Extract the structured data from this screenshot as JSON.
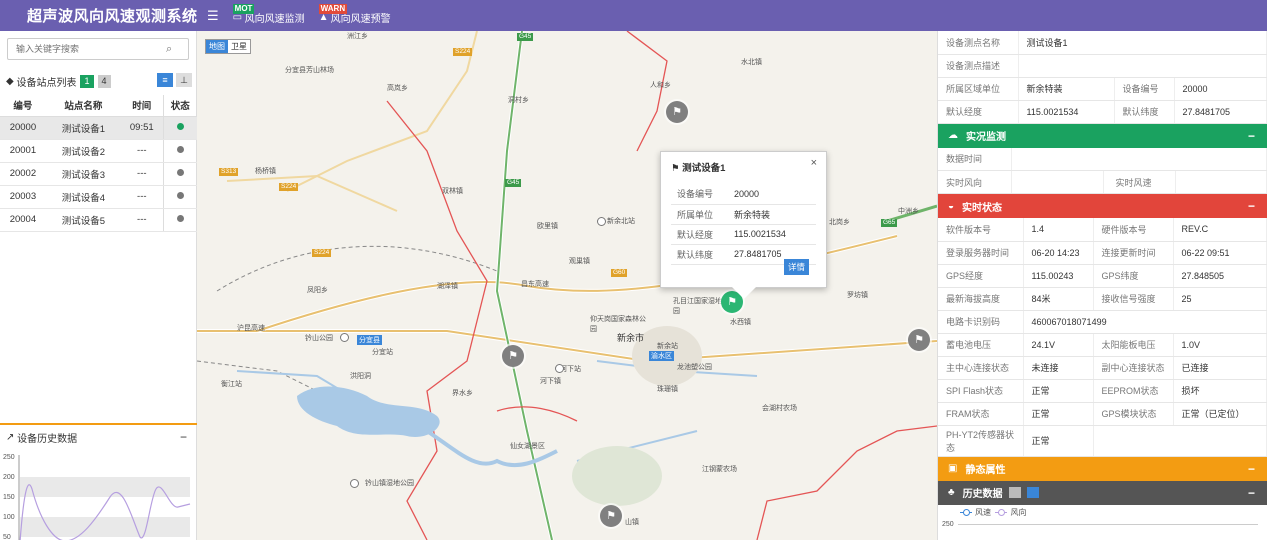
{
  "app": {
    "title": "超声波风向风速观测系统",
    "menu_icon": "hamburger-icon"
  },
  "nav": [
    {
      "tag": "MOT",
      "label": "风向风速监测",
      "icon": "monitor-icon"
    },
    {
      "tag": "WARN",
      "label": "风向风速预警",
      "icon": "warning-icon"
    }
  ],
  "left": {
    "search_placeholder": "输入关键字搜索",
    "list_title": "设备站点列表",
    "online_count": "1",
    "offline_count": "4",
    "columns": [
      "编号",
      "站点名称",
      "时间",
      "状态"
    ],
    "devices": [
      {
        "id": "20000",
        "name": "测试设备1",
        "time": "09:51",
        "status": "online"
      },
      {
        "id": "20001",
        "name": "测试设备2",
        "time": "---",
        "status": "offline"
      },
      {
        "id": "20002",
        "name": "测试设备3",
        "time": "---",
        "status": "offline"
      },
      {
        "id": "20003",
        "name": "测试设备4",
        "time": "---",
        "status": "offline"
      },
      {
        "id": "20004",
        "name": "测试设备5",
        "time": "---",
        "status": "offline"
      }
    ],
    "history_title": "设备历史数据",
    "history_y_ticks": [
      "250",
      "200",
      "150",
      "100",
      "50"
    ]
  },
  "map": {
    "type_buttons": [
      "地图",
      "卫星"
    ],
    "labels": [
      "分宜县芳山林场",
      "高岚乡",
      "洞村乡",
      "杨桥镇",
      "双林镇",
      "欧里镇",
      "新余北站",
      "观巢镇",
      "水北镇",
      "人和乡",
      "中洲乡",
      "罗坊镇",
      "凤阳乡",
      "湖泽镇",
      "昌东高速",
      "分宜县",
      "钤山公园",
      "分宜站",
      "孔目江国家湿地公园",
      "仰天岗国家森林公园",
      "新余市",
      "渝水区",
      "新余站",
      "河下站",
      "界水乡",
      "河下镇",
      "珠珊镇",
      "龙池塑公园",
      "洪阳洞",
      "衡江站",
      "沪昆高速",
      "会湖村农场",
      "江钢蒙农场",
      "仙女湖景区",
      "钤山镇湿地公园",
      "水西镇",
      "北岗乡",
      "洲江乡",
      "山镇"
    ],
    "road_tags": [
      "S224",
      "G45",
      "S313",
      "G60",
      "G45",
      "S224",
      "S224",
      "G65"
    ],
    "popup": {
      "title": "测试设备1",
      "rows": [
        {
          "k": "设备编号",
          "v": "20000"
        },
        {
          "k": "所属单位",
          "v": "新余特装"
        },
        {
          "k": "默认经度",
          "v": "115.0021534"
        },
        {
          "k": "默认纬度",
          "v": "27.8481705"
        }
      ],
      "detail_label": "详情"
    }
  },
  "right": {
    "info": {
      "name_k": "设备测点名称",
      "name_v": "测试设备1",
      "desc_k": "设备测点描述",
      "desc_v": "",
      "unit_k": "所属区域单位",
      "unit_v": "新余特装",
      "no_k": "设备编号",
      "no_v": "20000",
      "lng_k": "默认经度",
      "lng_v": "115.0021534",
      "lat_k": "默认纬度",
      "lat_v": "27.8481705"
    },
    "live": {
      "title": "实况监测",
      "time_k": "数据时间",
      "dir_k": "实时风向",
      "speed_k": "实时风速"
    },
    "status": {
      "title": "实时状态",
      "rows": [
        [
          "软件版本号",
          "1.4",
          "硬件版本号",
          "REV.C"
        ],
        [
          "登录服务器时间",
          "06-20 14:23",
          "连接更新时间",
          "06-22 09:51"
        ],
        [
          "GPS经度",
          "115.00243",
          "GPS纬度",
          "27.848505"
        ],
        [
          "最新海拔高度",
          "84米",
          "接收信号强度",
          "25"
        ]
      ],
      "sim_k": "电路卡识别码",
      "sim_v": "460067018071499",
      "rows2": [
        [
          "蓄电池电压",
          "24.1V",
          "太阳能板电压",
          "1.0V"
        ],
        [
          "主中心连接状态",
          "未连接",
          "副中心连接状态",
          "已连接"
        ],
        [
          "SPI Flash状态",
          "正常",
          "EEPROM状态",
          "损坏"
        ],
        [
          "FRAM状态",
          "正常",
          "GPS模块状态",
          "正常（已定位）"
        ]
      ],
      "sensor_k": "PH-YT2传感器状态",
      "sensor_v": "正常"
    },
    "static_title": "静态属性",
    "history_title": "历史数据",
    "legend": [
      "风速",
      "风向"
    ],
    "y_top": "250"
  }
}
